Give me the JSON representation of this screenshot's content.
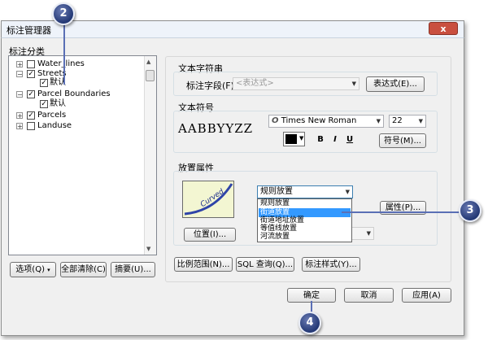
{
  "window": {
    "title": "标注管理器",
    "close_label": "x"
  },
  "left": {
    "section_label": "标注分类",
    "tree": [
      {
        "label": "Water_lines",
        "expander": "+",
        "checked": false
      },
      {
        "label": "Streets",
        "expander": "−",
        "checked": true
      },
      {
        "label": "默认",
        "child": true,
        "checked": true
      },
      {
        "label": "Parcel Boundaries",
        "expander": "−",
        "checked": true
      },
      {
        "label": "默认",
        "child": true,
        "checked": true
      },
      {
        "label": "Parcels",
        "expander": "+",
        "checked": true
      },
      {
        "label": "Landuse",
        "expander": "+",
        "checked": false
      }
    ],
    "buttons": {
      "options": "选项(Q)",
      "clear_all": "全部清除(C)",
      "summary": "摘要(U)..."
    }
  },
  "text_string": {
    "heading": "文本字符串",
    "field_label": "标注字段(F):",
    "field_value": "<表达式>",
    "expression_button": "表达式(E)..."
  },
  "text_symbol": {
    "heading": "文本符号",
    "sample_text": "AABBYYZZ",
    "font_icon": "O",
    "font_name": "Times New Roman",
    "font_size": "22",
    "bold": "B",
    "italic": "I",
    "underline": "U",
    "symbol_button": "符号(M)...",
    "color": "#000000"
  },
  "placement": {
    "heading": "放置属性",
    "preview_text": "Curved",
    "selected": "规则放置",
    "options": [
      "规则放置",
      "街道放置",
      "街道地址放置",
      "等值线放置",
      "河流放置"
    ],
    "highlighted_index": 1,
    "properties_button": "属性(P)...",
    "position_button": "位置(I)..."
  },
  "bottom_buttons": {
    "scale_range": "比例范围(N)...",
    "sql_query": "SQL 查询(Q)...",
    "label_styles": "标注样式(Y)..."
  },
  "dialog_buttons": {
    "ok": "确定",
    "cancel": "取消",
    "apply": "应用(A)"
  },
  "callouts": [
    "2",
    "3",
    "4"
  ],
  "colors": {
    "callout": "#2d4386",
    "selection": "#3399ff",
    "preview_bg": "#f3f6d2"
  }
}
